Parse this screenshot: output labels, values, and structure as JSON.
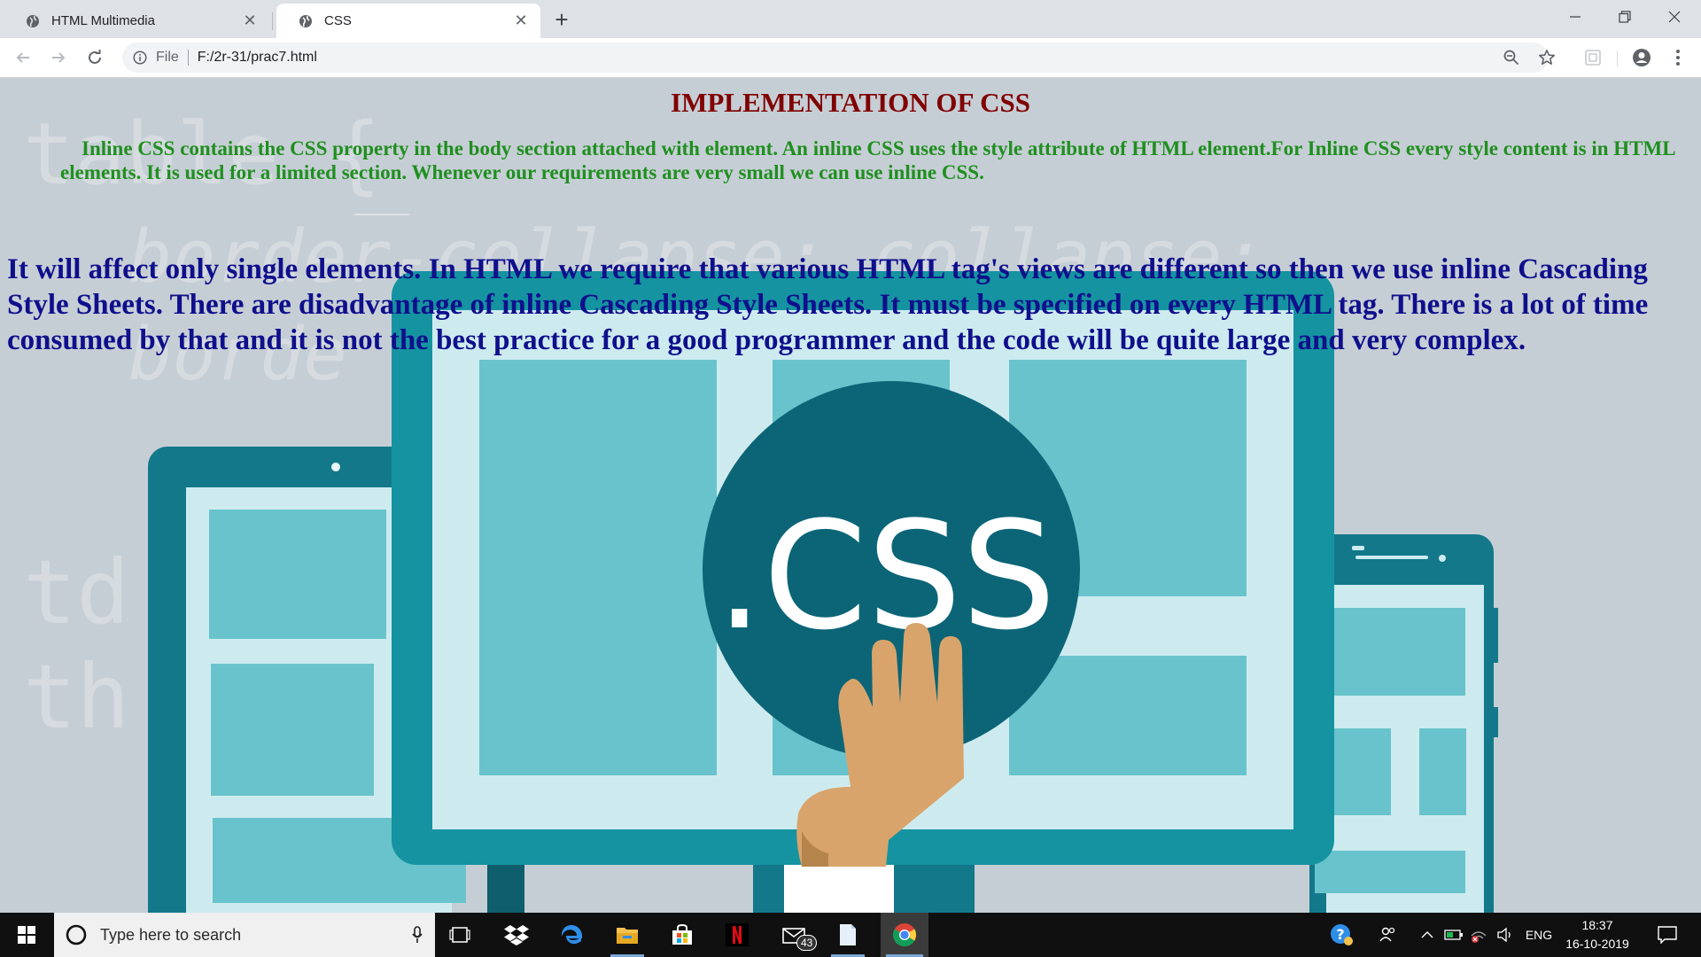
{
  "browser": {
    "tabs": [
      {
        "title": "HTML Multimedia",
        "active": false,
        "icon": "globe-icon"
      },
      {
        "title": "CSS",
        "active": true,
        "icon": "globe-icon"
      }
    ],
    "address": {
      "scheme_label": "File",
      "url": "F:/2r-31/prac7.html"
    }
  },
  "page": {
    "title": "IMPLEMENTATION OF CSS",
    "paragraph1": "Inline CSS contains the CSS property in the body section attached with element. An inline CSS uses the style attribute of HTML element.For Inline CSS every style content is in HTML elements. It is used for a limited section. Whenever our requirements are very small we can use inline CSS.",
    "paragraph2": "It will affect only single elements. In HTML we require that various HTML tag's views are different so then we use inline Cascading Style Sheets. There are disadvantage of inline Cascading Style Sheets. It must be specified on every HTML tag. There is a lot of time consumed by that and it is not the best practice for a good programmer and the code will be quite large and very complex.",
    "background": {
      "logo_text": ".CSS",
      "code_words": [
        "table {",
        "border-collapse: collapse;",
        "borde",
        "td",
        "th"
      ]
    },
    "colors": {
      "title": "#800000",
      "paragraph1": "#1f8f1f",
      "paragraph2": "#0f0f8c",
      "background": "#c6ced5"
    }
  },
  "taskbar": {
    "search_placeholder": "Type here to search",
    "mail_badge": "43",
    "language": "ENG",
    "time": "18:37",
    "date": "16-10-2019"
  }
}
